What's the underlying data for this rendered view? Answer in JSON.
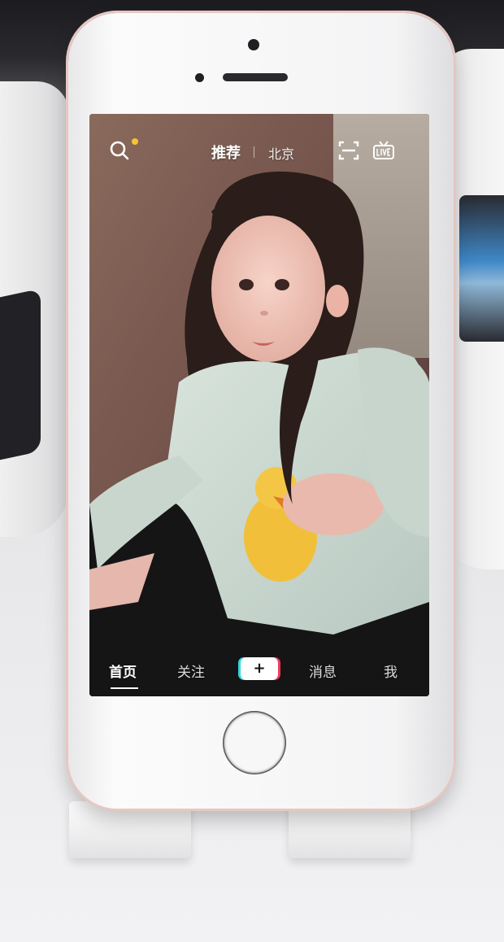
{
  "app": {
    "top_tabs": {
      "recommended": "推荐",
      "city": "北京"
    },
    "bottom_nav": {
      "home": "首页",
      "following": "关注",
      "create": "+",
      "messages": "消息",
      "me": "我"
    },
    "active_tab": "首页",
    "accent_colors": {
      "notification_dot": "#f5c431",
      "create_left": "#33d7e0",
      "create_right": "#f03a5d"
    },
    "icons": [
      "search-icon",
      "scan-icon",
      "live-icon"
    ]
  }
}
